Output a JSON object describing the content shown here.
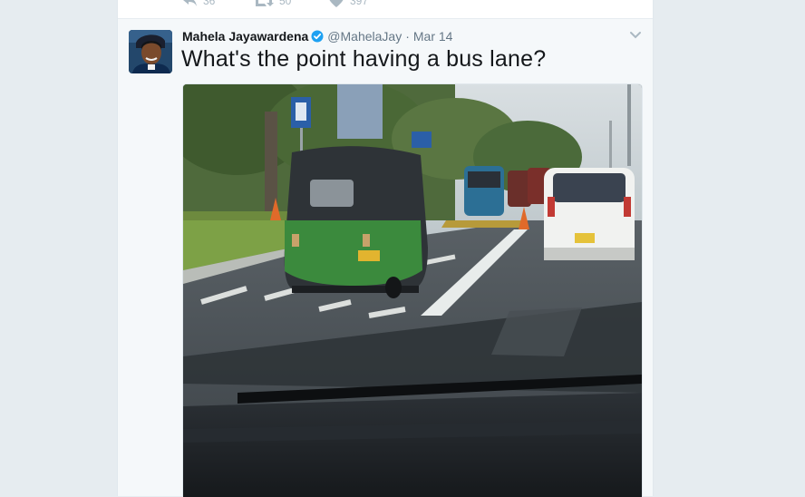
{
  "previous_tweet": {
    "reply_count": "36",
    "retweet_count": "50",
    "like_count": "397"
  },
  "tweet": {
    "fullname": "Mahela Jayawardena",
    "handle": "@MahelaJay",
    "separator": "·",
    "timestamp": "Mar 14",
    "text": "What's the point having a bus lane?",
    "verified": true
  },
  "colors": {
    "verified_badge": "#1da1f2",
    "icon_gray": "#aab8c2",
    "secondary_text": "#657786",
    "tweet_background": "#f5f8fa"
  },
  "icons": [
    "reply-icon",
    "retweet-icon",
    "like-icon",
    "verified-badge-icon",
    "caret-down-icon"
  ]
}
